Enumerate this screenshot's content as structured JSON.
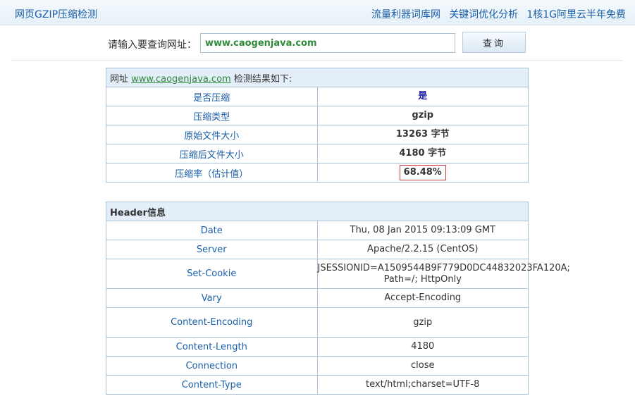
{
  "header": {
    "site_title": "网页GZIP压缩检测",
    "links": [
      "流量利器词库网",
      "关键词优化分析",
      "1核1G阿里云半年免费"
    ]
  },
  "search": {
    "label": "请输入要查询网址：",
    "value": "www.caogenjava.com",
    "button": "查询"
  },
  "result": {
    "prefix": "网址",
    "url": "www.caogenjava.com",
    "suffix": "检测结果如下:",
    "rows": [
      {
        "key": "是否压缩",
        "value": "是"
      },
      {
        "key": "压缩类型",
        "value": "gzip"
      },
      {
        "key": "原始文件大小",
        "value": "13263 字节"
      },
      {
        "key": "压缩后文件大小",
        "value": "4180 字节"
      },
      {
        "key": "压缩率（估计值）",
        "value": "68.48%"
      }
    ]
  },
  "header_info": {
    "title": "Header信息",
    "rows": [
      {
        "key": "Date",
        "value": "Thu, 08 Jan 2015 09:13:09 GMT"
      },
      {
        "key": "Server",
        "value": "Apache/2.2.15 (CentOS)"
      },
      {
        "key": "Set-Cookie",
        "value": "JSESSIONID=A1509544B9F779D0DC44832023FA120A; Path=/; HttpOnly"
      },
      {
        "key": "Vary",
        "value": "Accept-Encoding"
      },
      {
        "key": "Content-Encoding",
        "value": "gzip"
      },
      {
        "key": "Content-Length",
        "value": "4180"
      },
      {
        "key": "Connection",
        "value": "close"
      },
      {
        "key": "Content-Type",
        "value": "text/html;charset=UTF-8"
      }
    ]
  },
  "colors": {
    "link_blue": "#1a5fa8",
    "url_green": "#2e8b3a",
    "border": "#a9c3d8",
    "header_bg": "#e3eef8",
    "rate_border": "#d04040"
  }
}
